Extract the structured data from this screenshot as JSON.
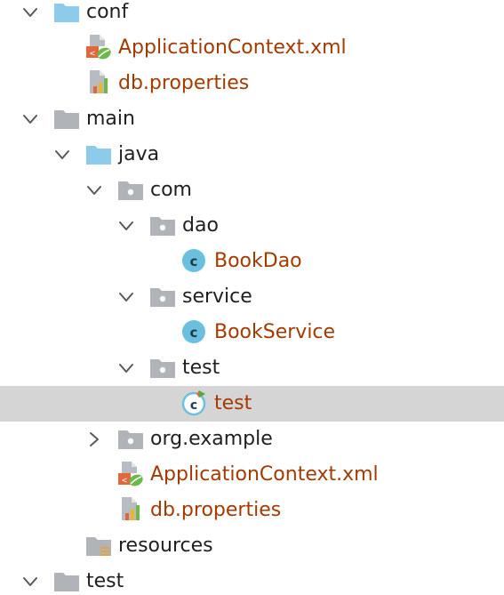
{
  "theme": {
    "selection_color": "#d5d5d5",
    "modified_text_color": "#a33a00",
    "normal_text_color": "#1f1f1f",
    "folder_blue": "#8dcbeb",
    "folder_gray": "#b0b4b9",
    "class_icon_color": "#6cc0df"
  },
  "tree": {
    "items": [
      {
        "label": "conf",
        "depth": 0,
        "arrow": "down",
        "icon": "folder-blue-icon",
        "modified": false
      },
      {
        "label": "ApplicationContext.xml",
        "depth": 1,
        "arrow": "none",
        "icon": "spring-xml-file-icon",
        "modified": true
      },
      {
        "label": "db.properties",
        "depth": 1,
        "arrow": "none",
        "icon": "properties-file-icon",
        "modified": true
      },
      {
        "label": "main",
        "depth": 0,
        "arrow": "down",
        "icon": "folder-gray-icon",
        "modified": false
      },
      {
        "label": "java",
        "depth": 1,
        "arrow": "down",
        "icon": "folder-blue-icon",
        "modified": false
      },
      {
        "label": "com",
        "depth": 2,
        "arrow": "down",
        "icon": "package-icon",
        "modified": false
      },
      {
        "label": "dao",
        "depth": 3,
        "arrow": "down",
        "icon": "package-icon",
        "modified": false
      },
      {
        "label": "BookDao",
        "depth": 4,
        "arrow": "none",
        "icon": "java-class-icon",
        "modified": true
      },
      {
        "label": "service",
        "depth": 3,
        "arrow": "down",
        "icon": "package-icon",
        "modified": false
      },
      {
        "label": "BookService",
        "depth": 4,
        "arrow": "none",
        "icon": "java-class-icon",
        "modified": true
      },
      {
        "label": "test",
        "depth": 3,
        "arrow": "down",
        "icon": "package-icon",
        "modified": false
      },
      {
        "label": "test",
        "depth": 4,
        "arrow": "none",
        "icon": "java-runnable-class-icon",
        "modified": true,
        "selected": true
      },
      {
        "label": "org.example",
        "depth": 2,
        "arrow": "right",
        "icon": "package-icon",
        "modified": false
      },
      {
        "label": "ApplicationContext.xml",
        "depth": 2,
        "arrow": "none",
        "icon": "spring-xml-file-icon",
        "modified": true
      },
      {
        "label": "db.properties",
        "depth": 2,
        "arrow": "none",
        "icon": "properties-file-icon",
        "modified": true
      },
      {
        "label": "resources",
        "depth": 1,
        "arrow": "none",
        "icon": "resources-folder-icon",
        "modified": false
      },
      {
        "label": "test",
        "depth": 0,
        "arrow": "down",
        "icon": "folder-gray-icon",
        "modified": false
      }
    ]
  }
}
